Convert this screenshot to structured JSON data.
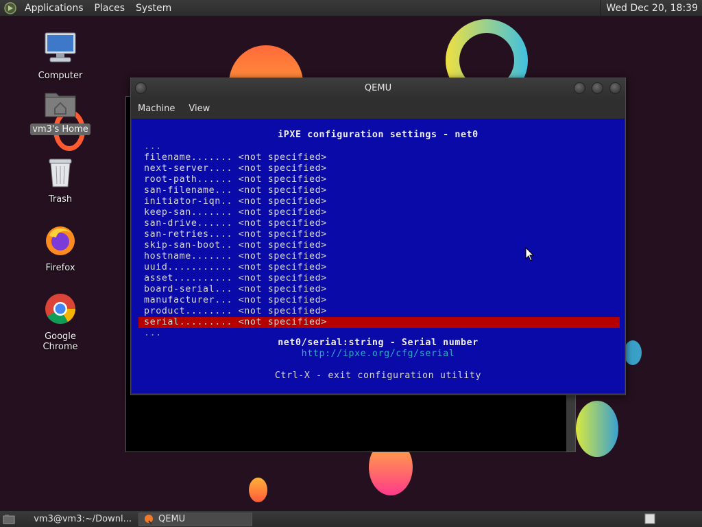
{
  "top_panel": {
    "menus": [
      "Applications",
      "Places",
      "System"
    ],
    "clock": "Wed Dec 20, 18:39"
  },
  "desktop_icons": [
    {
      "label": "Computer",
      "icon": "computer-icon"
    },
    {
      "label": "vm3's Home",
      "icon": "home-folder-icon",
      "selected": true
    },
    {
      "label": "Trash",
      "icon": "trash-icon"
    },
    {
      "label": "Firefox",
      "icon": "firefox-icon"
    },
    {
      "label": "Google Chrome",
      "icon": "chrome-icon"
    }
  ],
  "qemu": {
    "title": "QEMU",
    "menus": [
      "Machine",
      "View"
    ],
    "screen": {
      "heading": "iPXE configuration settings - net0",
      "ellipsis_top": "...",
      "settings": [
        {
          "name": "filename.......",
          "value": "<not specified>"
        },
        {
          "name": "next-server....",
          "value": "<not specified>"
        },
        {
          "name": "root-path......",
          "value": "<not specified>"
        },
        {
          "name": "san-filename...",
          "value": "<not specified>"
        },
        {
          "name": "initiator-iqn..",
          "value": "<not specified>"
        },
        {
          "name": "keep-san.......",
          "value": "<not specified>"
        },
        {
          "name": "san-drive......",
          "value": "<not specified>"
        },
        {
          "name": "san-retries....",
          "value": "<not specified>"
        },
        {
          "name": "skip-san-boot..",
          "value": "<not specified>"
        },
        {
          "name": "hostname.......",
          "value": "<not specified>"
        },
        {
          "name": "uuid...........",
          "value": "<not specified>"
        },
        {
          "name": "asset..........",
          "value": "<not specified>"
        },
        {
          "name": "board-serial...",
          "value": "<not specified>"
        },
        {
          "name": "manufacturer...",
          "value": "<not specified>"
        },
        {
          "name": "product........",
          "value": "<not specified>"
        },
        {
          "name": "serial.........",
          "value": "<not specified>",
          "selected": true
        }
      ],
      "ellipsis_bottom": "...",
      "description": "net0/serial:string - Serial number",
      "help_url": "http://ipxe.org/cfg/serial",
      "footer": "Ctrl-X - exit configuration utility"
    }
  },
  "taskbar": {
    "tasks": [
      {
        "label": "vm3@vm3:~/Downl...",
        "icon": "terminal-icon",
        "active": false
      },
      {
        "label": "QEMU",
        "icon": "qemu-icon",
        "active": true
      }
    ]
  },
  "colors": {
    "screen_bg": "#0a0aa8",
    "selection": "#b50000",
    "link": "#2fa9c9"
  }
}
